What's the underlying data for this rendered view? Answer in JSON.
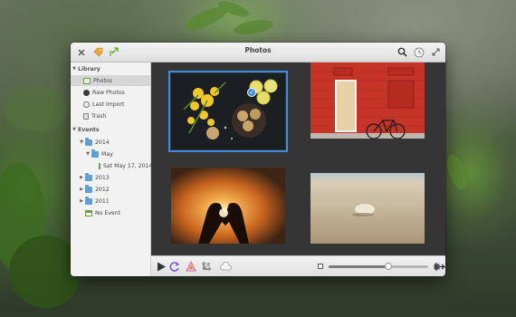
{
  "window": {
    "title": "Photos"
  },
  "sidebar": {
    "library": {
      "label": "Library",
      "items": [
        {
          "label": "Photos",
          "icon": "photos-icon",
          "selected": true
        },
        {
          "label": "Raw Photos",
          "icon": "raw-photos-icon"
        },
        {
          "label": "Last Import",
          "icon": "last-import-icon"
        },
        {
          "label": "Trash",
          "icon": "trash-icon"
        }
      ]
    },
    "events": {
      "label": "Events",
      "tree": {
        "y2014": "2014",
        "may": "May",
        "day": "Sat May 17, 2014",
        "y2013": "2013",
        "y2012": "2012",
        "y2011": "2011",
        "no_event": "No Event"
      }
    }
  },
  "photos": [
    {
      "subject": "yellow flowers, lemon slices and cookies",
      "selected": true
    },
    {
      "subject": "red brick wall with door and bicycle"
    },
    {
      "subject": "hands forming a heart at sunset"
    },
    {
      "subject": "seashell on sandy beach"
    }
  ],
  "zoom": {
    "level": 0.6
  },
  "colors": {
    "accent": "#3c8be0",
    "content_bg": "#353535"
  }
}
